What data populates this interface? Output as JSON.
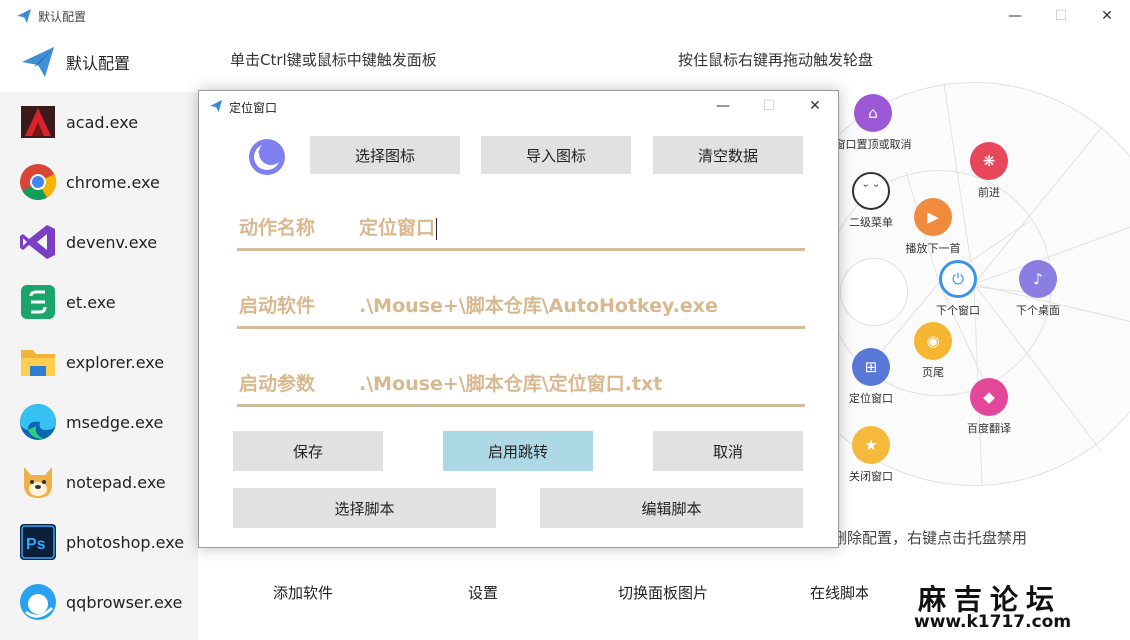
{
  "main_window": {
    "title": "默认配置",
    "controls": {
      "minimize": "—",
      "maximize": "☐",
      "close": "✕"
    }
  },
  "sidebar": {
    "items": [
      {
        "label": "默认配置",
        "icon": "paper-plane-icon"
      },
      {
        "label": "acad.exe",
        "icon": "autocad-icon"
      },
      {
        "label": "chrome.exe",
        "icon": "chrome-icon"
      },
      {
        "label": "devenv.exe",
        "icon": "visual-studio-icon"
      },
      {
        "label": "et.exe",
        "icon": "wps-sheet-icon"
      },
      {
        "label": "explorer.exe",
        "icon": "folder-icon"
      },
      {
        "label": "msedge.exe",
        "icon": "edge-icon"
      },
      {
        "label": "notepad.exe",
        "icon": "dog-icon"
      },
      {
        "label": "photoshop.exe",
        "icon": "photoshop-icon"
      },
      {
        "label": "qqbrowser.exe",
        "icon": "qqbrowser-icon"
      }
    ]
  },
  "main": {
    "hint_left": "单击Ctrl键或鼠标中键触发面板",
    "hint_right": "按住鼠标右键再拖动触发轮盘",
    "bottom_hint": "删除配置，右键点击托盘禁用",
    "wheel": {
      "items": [
        {
          "label": "窗口置顶或取消",
          "icon": "pin-window-icon"
        },
        {
          "label": "前进",
          "icon": "forward-icon"
        },
        {
          "label": "二级菜单",
          "icon": "bilibili-icon"
        },
        {
          "label": "播放下一首",
          "icon": "play-next-icon"
        },
        {
          "label": "下个窗口",
          "icon": "power-icon"
        },
        {
          "label": "下个桌面",
          "icon": "music-icon"
        },
        {
          "label": "页尾",
          "icon": "bulb-icon"
        },
        {
          "label": "定位窗口",
          "icon": "locate-window-icon"
        },
        {
          "label": "百度翻译",
          "icon": "translate-icon"
        },
        {
          "label": "关闭窗口",
          "icon": "star-close-icon"
        }
      ]
    },
    "buttons": {
      "add_software": "添加软件",
      "settings": "设置",
      "switch_panel_image": "切换面板图片",
      "online_script": "在线脚本"
    }
  },
  "watermark": {
    "line1": "麻吉论坛",
    "line2": "www.k1717.com"
  },
  "dialog": {
    "title": "定位窗口",
    "controls": {
      "minimize": "—",
      "maximize": "☐",
      "close": "✕"
    },
    "buttons": {
      "choose_icon": "选择图标",
      "import_icon": "导入图标",
      "clear_data": "清空数据",
      "save": "保存",
      "enable_jump": "启用跳转",
      "cancel": "取消",
      "choose_script": "选择脚本",
      "edit_script": "编辑脚本"
    },
    "fields": {
      "action_name": {
        "label": "动作名称",
        "value": "定位窗口"
      },
      "launch_app": {
        "label": "启动软件",
        "value": ".\\Mouse+\\脚本仓库\\AutoHotkey.exe"
      },
      "launch_args": {
        "label": "启动参数",
        "value": ".\\Mouse+\\脚本仓库\\定位窗口.txt"
      }
    }
  }
}
